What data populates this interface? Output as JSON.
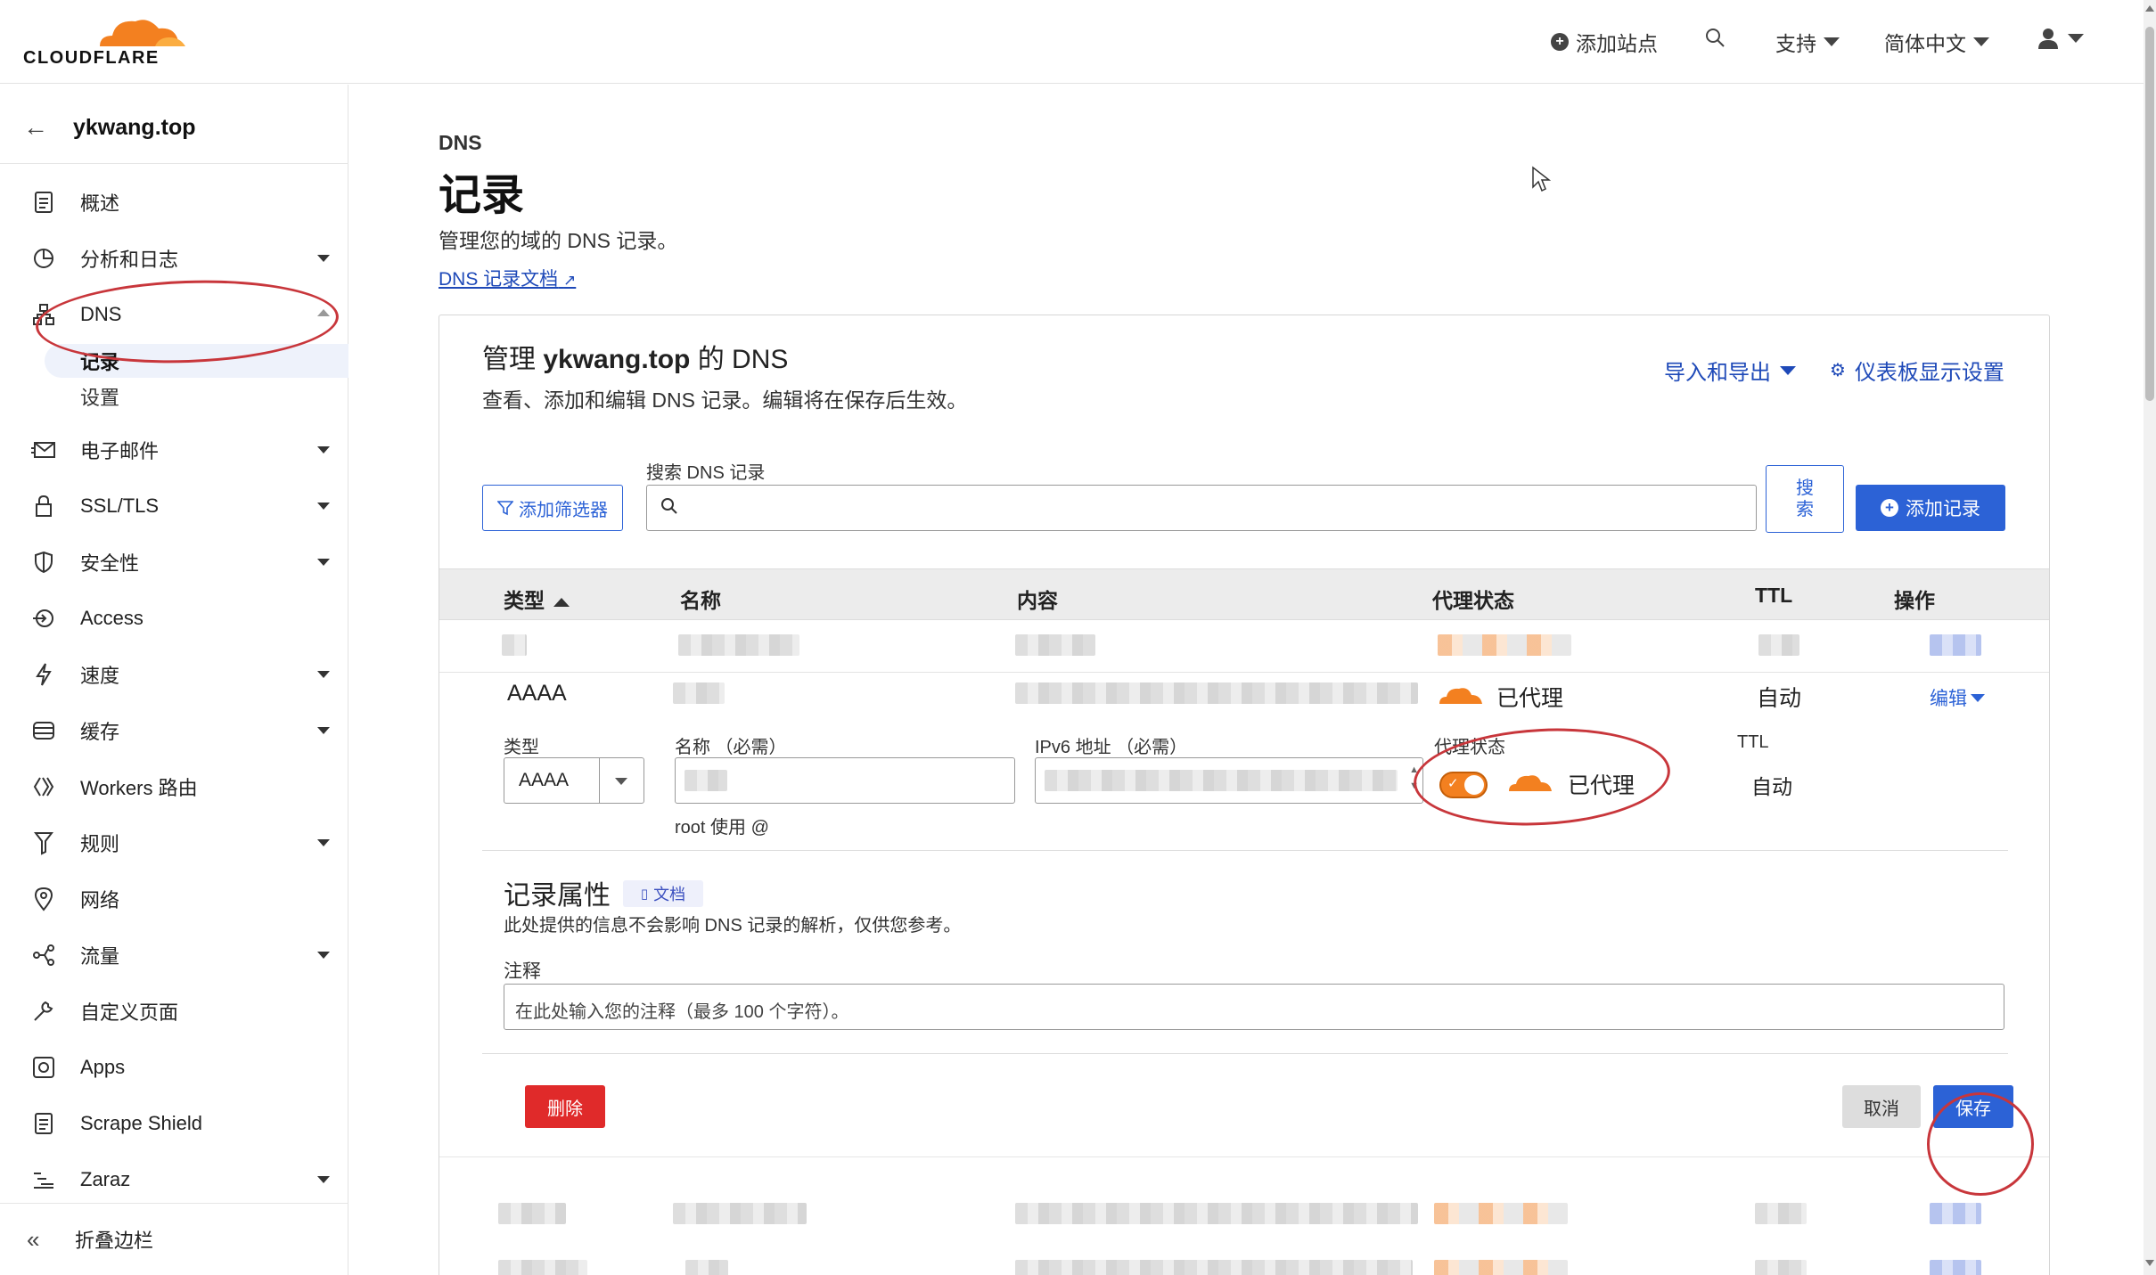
{
  "brand": {
    "name": "CLOUDFLARE",
    "accent": "#f38020"
  },
  "topnav": {
    "add_site": "添加站点",
    "search_icon": "search-icon",
    "support": "支持",
    "language": "简体中文",
    "account_icon": "user-icon"
  },
  "sidebar": {
    "back_icon": "arrow-left-icon",
    "site": "ykwang.top",
    "items": [
      {
        "label": "概述",
        "icon": "document-icon"
      },
      {
        "label": "分析和日志",
        "icon": "pie-chart-icon"
      },
      {
        "label": "DNS",
        "icon": "network-icon"
      },
      {
        "label": "电子邮件",
        "icon": "envelope-icon"
      },
      {
        "label": "SSL/TLS",
        "icon": "lock-icon"
      },
      {
        "label": "安全性",
        "icon": "shield-icon"
      },
      {
        "label": "Access",
        "icon": "access-icon"
      },
      {
        "label": "速度",
        "icon": "lightning-icon"
      },
      {
        "label": "缓存",
        "icon": "storage-icon"
      },
      {
        "label": "Workers 路由",
        "icon": "workers-icon"
      },
      {
        "label": "规则",
        "icon": "funnel-icon"
      },
      {
        "label": "网络",
        "icon": "location-pin-icon"
      },
      {
        "label": "流量",
        "icon": "traffic-icon"
      },
      {
        "label": "自定义页面",
        "icon": "wrench-icon"
      },
      {
        "label": "Apps",
        "icon": "apps-icon"
      },
      {
        "label": "Scrape Shield",
        "icon": "document-icon"
      },
      {
        "label": "Zaraz",
        "icon": "zaraz-icon"
      }
    ],
    "dns_sub": [
      "记录",
      "设置"
    ],
    "collapse": "折叠边栏"
  },
  "page": {
    "crumb": "DNS",
    "title": "记录",
    "desc": "管理您的域的 DNS 记录。",
    "doc_link": "DNS 记录文档"
  },
  "card": {
    "title_prefix": "管理 ",
    "title_domain": "ykwang.top",
    "title_suffix": " 的 DNS",
    "desc": "查看、添加和编辑 DNS 记录。编辑将在保存后生效。",
    "import_export": "导入和导出",
    "dashboard_settings": "仪表板显示设置",
    "filter_btn": "添加筛选器",
    "search_label": "搜索 DNS 记录",
    "search_btn": "搜索",
    "add_record": "添加记录"
  },
  "table": {
    "headers": [
      "类型",
      "名称",
      "内容",
      "代理状态",
      "TTL",
      "操作"
    ],
    "row": {
      "type": "AAAA",
      "proxy": "已代理",
      "ttl": "自动",
      "action": "编辑"
    }
  },
  "editor": {
    "type_label": "类型",
    "type_value": "AAAA",
    "name_label": "名称 （必需）",
    "name_hint": "root 使用 @",
    "ipv6_label": "IPv6 地址 （必需）",
    "proxy_label": "代理状态",
    "proxy_value": "已代理",
    "ttl_label": "TTL",
    "ttl_value": "自动"
  },
  "attributes": {
    "title": "记录属性",
    "doc_badge": "文档",
    "desc": "此处提供的信息不会影响 DNS 记录的解析，仅供您参考。",
    "note_label": "注释",
    "note_placeholder": "在此处输入您的注释（最多 100 个字符）。"
  },
  "actions": {
    "delete": "删除",
    "cancel": "取消",
    "save": "保存"
  },
  "colors": {
    "link": "#1e49b8",
    "primary": "#2c62d6",
    "danger": "#e02a2a",
    "annotation": "#c8363b"
  }
}
